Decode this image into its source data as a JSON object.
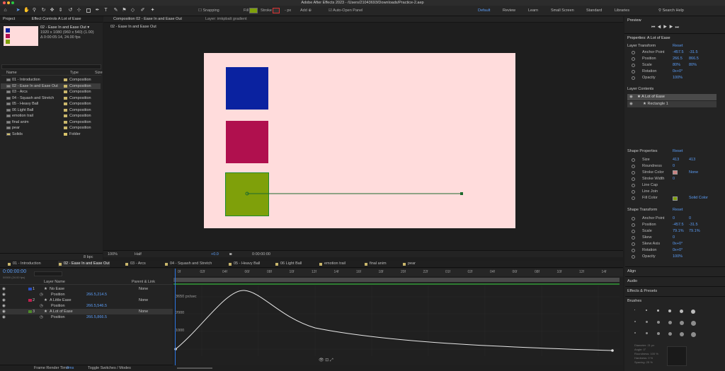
{
  "window": {
    "title": "Adobe After Effects 2023 - /Users/21043693/Downloads/Practice-2.aep"
  },
  "toolbar": {
    "snapping": "Snapping",
    "fill_label": "Fill",
    "stroke_label": "Stroke",
    "stroke_width": "- px",
    "add_label": "Add",
    "auto_open": "Auto-Open Panel",
    "fill_color": "#7fa00a",
    "workspaces": [
      "Default",
      "Review",
      "Learn",
      "Small Screen",
      "Standard",
      "Libraries"
    ],
    "search": "Search Help"
  },
  "project": {
    "tab": "Project",
    "effect_controls": "Effect Controls A Lot of Ease",
    "comp_name": "02 - Ease In and Ease Out ▾",
    "comp_info1": "1920 x 1080 (960 x 540) (1.00)",
    "comp_info2": "Δ 0:00:05:14, 24.00 fps",
    "col_name": "Name",
    "col_type": "Type",
    "col_size": "Size",
    "items": [
      {
        "name": "01 - Introduction",
        "type": "Composition",
        "color": "#c9b66b"
      },
      {
        "name": "02 - Ease In and Ease Out",
        "type": "Composition",
        "color": "#c9b66b"
      },
      {
        "name": "03 - Arcs",
        "type": "Composition",
        "color": "#c9b66b"
      },
      {
        "name": "04 - Squash and Stretch",
        "type": "Composition",
        "color": "#c9b66b"
      },
      {
        "name": "05 - Heavy Ball",
        "type": "Composition",
        "color": "#c9b66b"
      },
      {
        "name": "06 Light Ball",
        "type": "Composition",
        "color": "#c9b66b"
      },
      {
        "name": "emotion trail",
        "type": "Composition",
        "color": "#c9b66b"
      },
      {
        "name": "final anim",
        "type": "Composition",
        "color": "#c9b66b"
      },
      {
        "name": "pear",
        "type": "Composition",
        "color": "#c9b66b"
      },
      {
        "name": "Solids",
        "type": "Folder",
        "color": "#d8c36a"
      }
    ],
    "bpc": "8 bpc"
  },
  "composition": {
    "tab": "Composition 02 - Ease In and Ease Out",
    "layer_tab": "Layer: imkpbalt gradient",
    "sub_tab": "02 - Ease In and Ease Out",
    "zoom": "100%",
    "resolution": "Half",
    "time": "0:00:00:00",
    "exposure": "+0.0",
    "bg_color": "#ffdcdc",
    "squares": [
      {
        "name": "No Ease",
        "color": "#0a22a0"
      },
      {
        "name": "A Little Ease",
        "color": "#b0104e"
      },
      {
        "name": "A Lot of Ease",
        "color": "#7fa00a"
      }
    ]
  },
  "timeline_tabs": [
    "01 - Introduction",
    "02 - Ease In and Ease Out",
    "03 - Arcs",
    "04 - Squash and Stretch",
    "05 - Heavy Ball",
    "06 Light Ball",
    "emotion trail",
    "final anim",
    "pear"
  ],
  "timeline": {
    "time": "0:00:00:00",
    "time_sub": "00000 (24.00 fps)",
    "col_layer": "Layer Name",
    "col_parent": "Parent & Link",
    "layers": [
      {
        "num": "1",
        "name": "No Ease",
        "color": "#2b4fc0",
        "parent": "None"
      },
      {
        "num": "",
        "name": "Position",
        "value": "266.5,214.5"
      },
      {
        "num": "2",
        "name": "A Little Ease",
        "color": "#c0204f",
        "parent": "None"
      },
      {
        "num": "",
        "name": "Position",
        "value": "266.5,546.5"
      },
      {
        "num": "3",
        "name": "A Lot of Ease",
        "color": "#4e8a2a",
        "parent": "None"
      },
      {
        "num": "",
        "name": "Position",
        "value": "266.5,866.5"
      }
    ],
    "ruler": [
      "0f",
      "02f",
      "04f",
      "06f",
      "08f",
      "10f",
      "12f",
      "14f",
      "16f",
      "18f",
      "20f",
      "22f",
      "01f",
      "02f",
      "04f",
      "06f",
      "08f",
      "10f",
      "12f",
      "14f"
    ],
    "graph_labels": [
      "3650 px/sec",
      "2000",
      "1000"
    ],
    "render_time_label": "Frame Render Time",
    "render_time": "0ms",
    "toggle": "Toggle Switches / Modes"
  },
  "preview": {
    "title": "Preview"
  },
  "properties": {
    "title": "Properties: A Lot of Ease",
    "layer_transform": "Layer Transform",
    "reset": "Reset",
    "transform_rows": [
      {
        "label": "Anchor Point",
        "v1": "-457.5",
        "v2": "-31.5"
      },
      {
        "label": "Position",
        "v1": "266.5",
        "v2": "866.5"
      },
      {
        "label": "Scale",
        "v1": "80%",
        "v2": "80%"
      },
      {
        "label": "Rotation",
        "v1": "0x+0°",
        "v2": ""
      },
      {
        "label": "Opacity",
        "v1": "100%",
        "v2": ""
      }
    ],
    "layer_contents": "Layer Contents",
    "contents": [
      "A Lot of Ease",
      "Rectangle 1"
    ],
    "shape_properties": "Shape Properties",
    "shape_rows": [
      {
        "label": "Size",
        "v1": "413",
        "v2": "413"
      },
      {
        "label": "Roundness",
        "v1": "0",
        "v2": ""
      },
      {
        "label": "Stroke Color",
        "v1": "",
        "v2": "None"
      },
      {
        "label": "Stroke Width",
        "v1": "0",
        "v2": ""
      },
      {
        "label": "Line Cap",
        "v1": "",
        "v2": ""
      },
      {
        "label": "Line Join",
        "v1": "",
        "v2": ""
      },
      {
        "label": "Fill Color",
        "v1": "",
        "v2": "Solid Color"
      }
    ],
    "shape_transform": "Shape Transform",
    "shape_transform_rows": [
      {
        "label": "Anchor Point",
        "v1": "0",
        "v2": "0"
      },
      {
        "label": "Position",
        "v1": "-457.5",
        "v2": "-31.5"
      },
      {
        "label": "Scale",
        "v1": "79.1%",
        "v2": "79.1%"
      },
      {
        "label": "Skew",
        "v1": "0",
        "v2": ""
      },
      {
        "label": "Skew Axis",
        "v1": "0x+0°",
        "v2": ""
      },
      {
        "label": "Rotation",
        "v1": "0x+0°",
        "v2": ""
      },
      {
        "label": "Opacity",
        "v1": "100%",
        "v2": ""
      }
    ]
  },
  "side_sections": [
    "Align",
    "Audio",
    "Effects & Presets",
    "Brushes"
  ],
  "brushes": {
    "diameter": "Diameter: 21 px",
    "angle": "Angle: 0°",
    "roundness": "Roundness: 100 %",
    "hardness": "Hardness: 0 %",
    "spacing": "Spacing: 25 %"
  }
}
